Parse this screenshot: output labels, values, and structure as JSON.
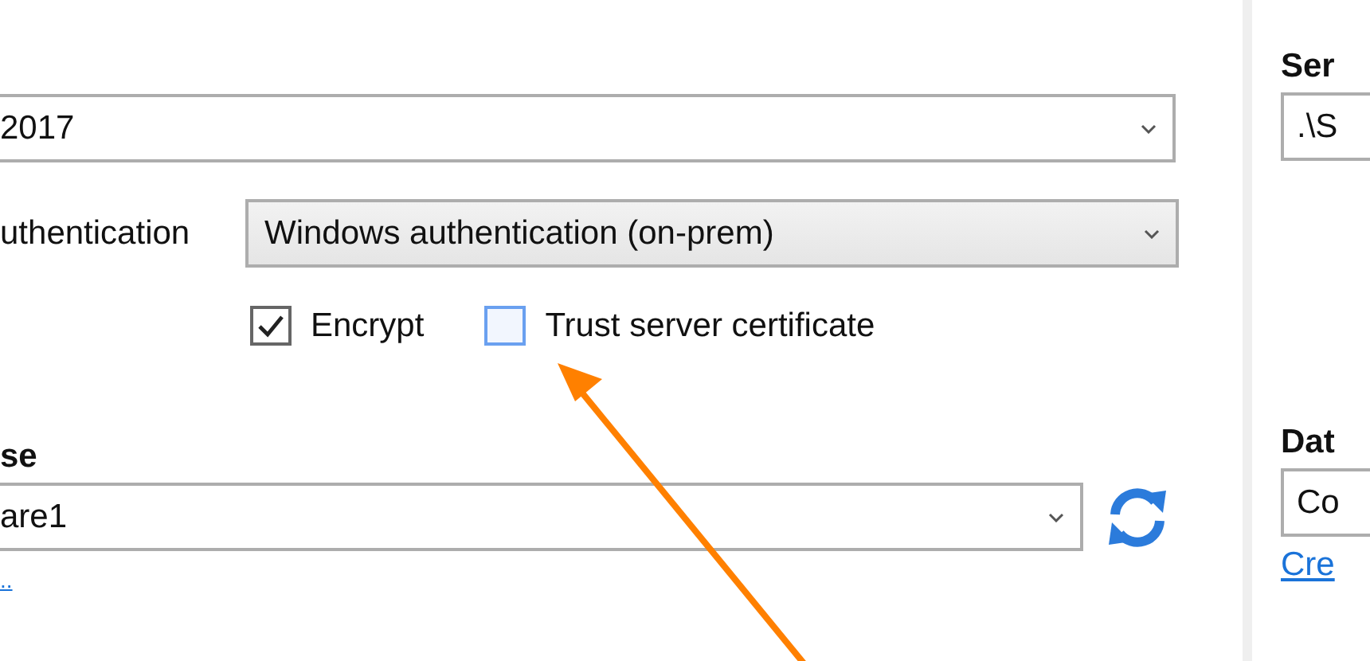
{
  "left_panel": {
    "server_type": {
      "value": "2017"
    },
    "authentication": {
      "label": "uthentication",
      "value": "Windows authentication (on-prem)"
    },
    "options": [
      {
        "label": "Encrypt",
        "checked": true,
        "focused": false
      },
      {
        "label": "Trust server certificate",
        "checked": false,
        "focused": true
      }
    ],
    "database": {
      "label": "se",
      "value": "are1"
    },
    "link": ".."
  },
  "right_panel": {
    "server": {
      "label": "Ser",
      "value": ".\\S"
    },
    "database": {
      "label": "Dat",
      "value": "Co"
    },
    "link": "Cre"
  }
}
